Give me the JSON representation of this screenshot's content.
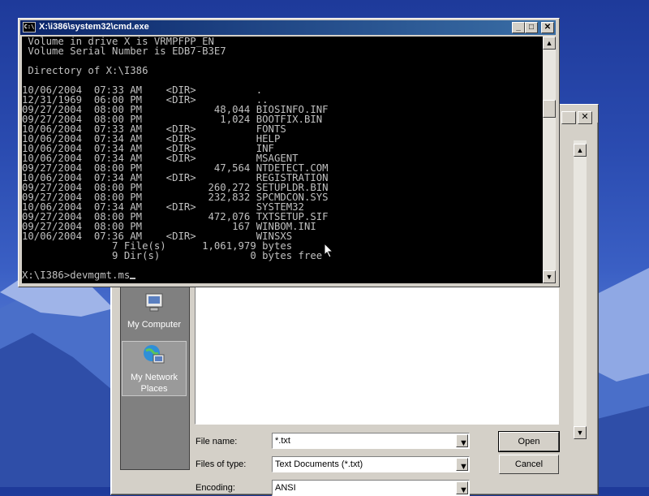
{
  "cmd": {
    "title": "X:\\i386\\system32\\cmd.exe",
    "icon_text": "C:\\",
    "controls": [
      "_",
      "□",
      "✕"
    ],
    "lines": [
      " Volume in drive X is VRMPFPP_EN",
      " Volume Serial Number is EDB7-B3E7",
      "",
      " Directory of X:\\I386",
      "",
      "10/06/2004  07:33 AM    <DIR>          .",
      "12/31/1969  06:00 PM    <DIR>          ..",
      "09/27/2004  08:00 PM            48,044 BIOSINFO.INF",
      "09/27/2004  08:00 PM             1,024 BOOTFIX.BIN",
      "10/06/2004  07:33 AM    <DIR>          FONTS",
      "10/06/2004  07:34 AM    <DIR>          HELP",
      "10/06/2004  07:34 AM    <DIR>          INF",
      "10/06/2004  07:34 AM    <DIR>          MSAGENT",
      "09/27/2004  08:00 PM            47,564 NTDETECT.COM",
      "10/06/2004  07:34 AM    <DIR>          REGISTRATION",
      "09/27/2004  08:00 PM           260,272 SETUPLDR.BIN",
      "09/27/2004  08:00 PM           232,832 SPCMDCON.SYS",
      "10/06/2004  07:34 AM    <DIR>          SYSTEM32",
      "09/27/2004  08:00 PM           472,076 TXTSETUP.SIF",
      "09/27/2004  08:00 PM               167 WINBOM.INI",
      "10/06/2004  07:36 AM    <DIR>          WINSXS",
      "               7 File(s)      1,061,979 bytes",
      "               9 Dir(s)               0 bytes free",
      "",
      "X:\\I386>devmgmt.ms"
    ]
  },
  "dialog": {
    "controls": [
      "✕"
    ],
    "places": [
      {
        "label": "My Computer"
      },
      {
        "label_line1": "My Network",
        "label_line2": "Places"
      }
    ],
    "file_name_label": "File name:",
    "file_name_value": "*.txt",
    "files_of_type_label": "Files of type:",
    "files_of_type_value": "Text Documents (*.txt)",
    "encoding_label": "Encoding:",
    "encoding_value": "ANSI",
    "open_button": "Open",
    "cancel_button": "Cancel"
  },
  "colors": {
    "titlebar_start": "#0a246a",
    "titlebar_end": "#3a6ea5",
    "console_bg": "#000000",
    "console_fg": "#c0c0c0",
    "chrome": "#d4d0c8"
  },
  "icons": [
    "cmd-app-icon",
    "minimize-icon",
    "maximize-icon",
    "close-icon",
    "my-computer-icon",
    "my-network-places-icon",
    "dropdown-arrow-icon",
    "scroll-up-icon",
    "scroll-down-icon",
    "mouse-pointer-icon"
  ]
}
